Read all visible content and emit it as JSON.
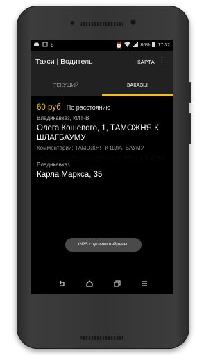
{
  "status_bar": {
    "left_icons": [
      "car-icon",
      "screenshot-icon",
      "b-icon"
    ],
    "battery_percent": "86%",
    "time": "17:32"
  },
  "app_bar": {
    "title": "Такси | Водитель",
    "map_button": "КАРТА",
    "menu_icon": "more-vert-icon"
  },
  "tabs": [
    {
      "label": "ТЕКУЩИЙ",
      "active": false
    },
    {
      "label": "ЗАКАЗЫ",
      "active": true
    }
  ],
  "order": {
    "price": "60 руб",
    "price_type": "По расстоянию",
    "from_city": "Владикавказ, КИТ-В",
    "from_address": "Олега Кошевого, 1, ТАМОЖНЯ К ШЛАГБАУМУ",
    "comment": "Комментарий: ТАМОЖНЯ К ШЛАГБАУМУ",
    "to_city": "Владикавказ",
    "to_address": "Карла Маркса, 35"
  },
  "toast": "GPS спутники найдены.",
  "colors": {
    "accent": "#f4c20d",
    "app_bar": "#212121",
    "background": "#000000",
    "toast": "#4a4a4a"
  }
}
